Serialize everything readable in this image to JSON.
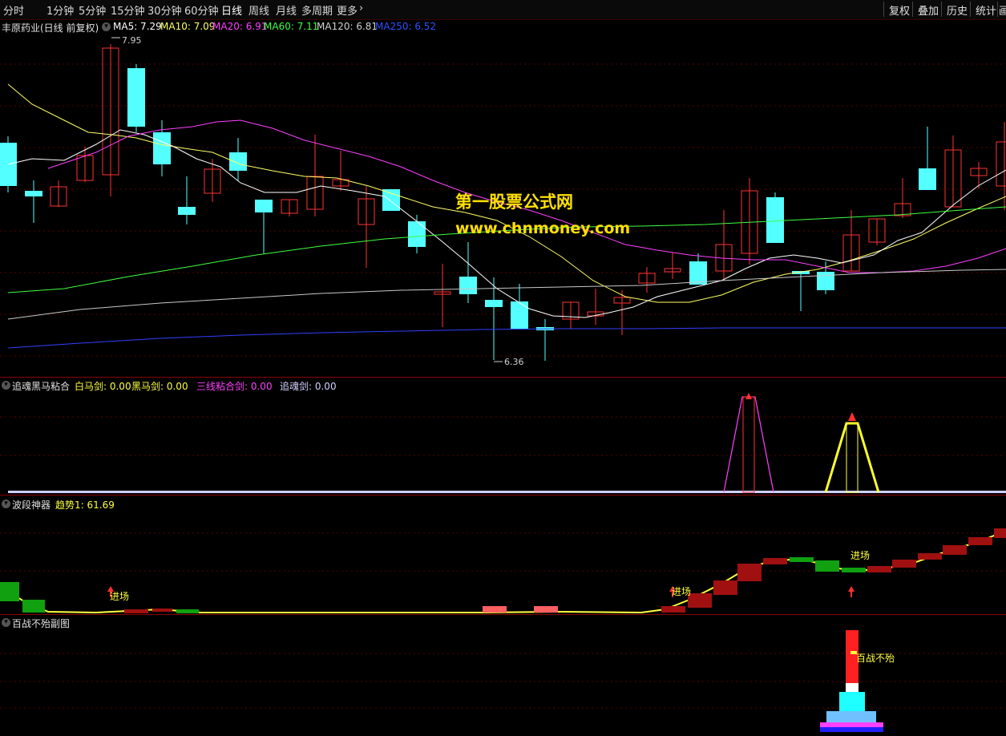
{
  "toolbar": {
    "tabs": [
      "分时",
      "1分钟",
      "5分钟",
      "15分钟",
      "30分钟",
      "60分钟",
      "日线",
      "周线",
      "月线",
      "多周期",
      "更多"
    ],
    "active_tab": "日线",
    "right_buttons": [
      "复权",
      "叠加",
      "历史",
      "统计",
      "画"
    ]
  },
  "main_panel": {
    "stock_title": "丰原药业(日线 前复权)",
    "ma_legend": [
      {
        "label": "MA5: 7.29",
        "color": "#ffffff"
      },
      {
        "label": "MA10: 7.09",
        "color": "#ffff66"
      },
      {
        "label": "MA20: 6.91",
        "color": "#ff40ff"
      },
      {
        "label": "MA60: 7.11",
        "color": "#40ff40"
      },
      {
        "label": "MA120: 6.81",
        "color": "#d0d0d0"
      },
      {
        "label": "MA250: 6.52",
        "color": "#3050ff"
      }
    ],
    "high_label": "7.95",
    "low_label": "6.36",
    "watermark_cn": "第一股票公式网",
    "watermark_url": "www.chnmoney.com"
  },
  "panel2": {
    "name": "追魂黑马粘合",
    "items": [
      {
        "label": "白马剑: 0.00",
        "color": "#ffff40"
      },
      {
        "label": "黑马剑: 0.00",
        "color": "#ffff40"
      },
      {
        "label": "三线粘合剑: 0.00",
        "color": "#ff40ff"
      },
      {
        "label": "追魂剑: 0.00",
        "color": "#d0d0ff"
      }
    ]
  },
  "panel3": {
    "name": "波段神器",
    "trend_label": "趋势1: 61.69",
    "signal_text": "进场"
  },
  "panel4": {
    "name": "百战不殆副图",
    "signal_text": "百战不殆"
  },
  "colors": {
    "up": "#ff3333",
    "down": "#54ffff",
    "border": "#8b0000"
  }
}
